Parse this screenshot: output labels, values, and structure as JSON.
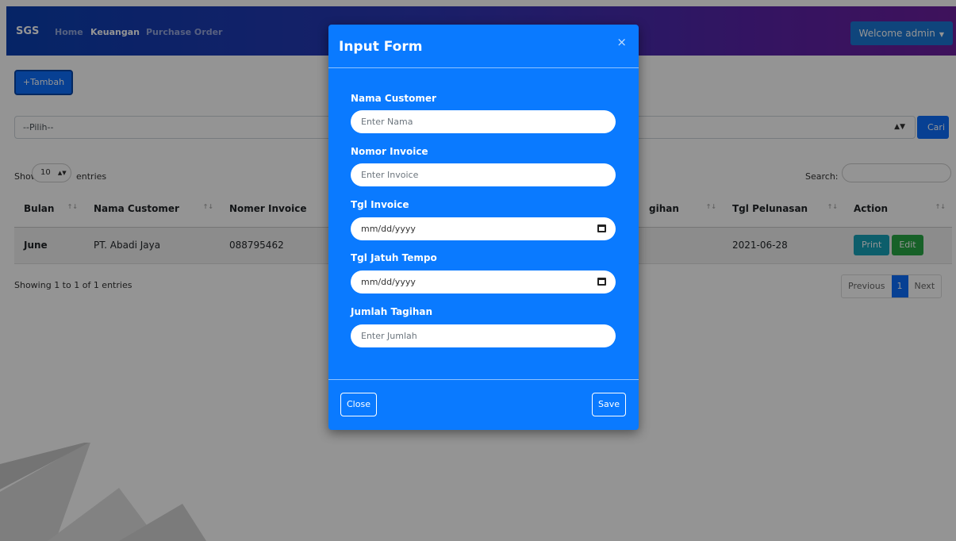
{
  "navbar": {
    "brand": "SGS",
    "links": [
      "Home",
      "Keuangan",
      "Purchase Order"
    ],
    "active_index": 1,
    "user_button": "Welcome admin",
    "user_caret": "▼"
  },
  "toolbar": {
    "add_label": "+Tambah"
  },
  "filter": {
    "selected": "--Pilih--",
    "search_button": "Cari"
  },
  "datatable": {
    "show_label": "Show",
    "length_value": "10",
    "entries_label": "entries",
    "search_label": "Search:",
    "columns": [
      "Bulan",
      "Nama Customer",
      "Nomer Invoice",
      "gihan",
      "Tgl Pelunasan",
      "Action"
    ],
    "rows": [
      {
        "bulan": "June",
        "nama_customer": "PT. Abadi Jaya",
        "nomer_invoice": "088795462",
        "tgl_pelunasan": "2021-06-28"
      }
    ],
    "actions": {
      "print": "Print",
      "edit": "Edit"
    },
    "info": "Showing 1 to 1 of 1 entries",
    "pagination": {
      "previous": "Previous",
      "current": "1",
      "next": "Next"
    }
  },
  "modal": {
    "title": "Input Form",
    "close_symbol": "×",
    "fields": [
      {
        "label": "Nama Customer",
        "placeholder": "Enter Nama"
      },
      {
        "label": "Nomor Invoice",
        "placeholder": "Enter Invoice"
      },
      {
        "label": "Tgl Invoice",
        "placeholder": "mm/dd/yyyy"
      },
      {
        "label": "Tgl Jatuh Tempo",
        "placeholder": "mm/dd/yyyy"
      },
      {
        "label": "Jumlah Tagihan",
        "placeholder": "Enter Jumlah"
      }
    ],
    "close_button": "Close",
    "save_button": "Save"
  },
  "colors": {
    "modal_bg": "#0a7aff",
    "navbar_start": "#0a3fb0",
    "navbar_end": "#6c1f9e",
    "primary": "#0d6efd",
    "print": "#17a2b8",
    "edit": "#28a745"
  }
}
